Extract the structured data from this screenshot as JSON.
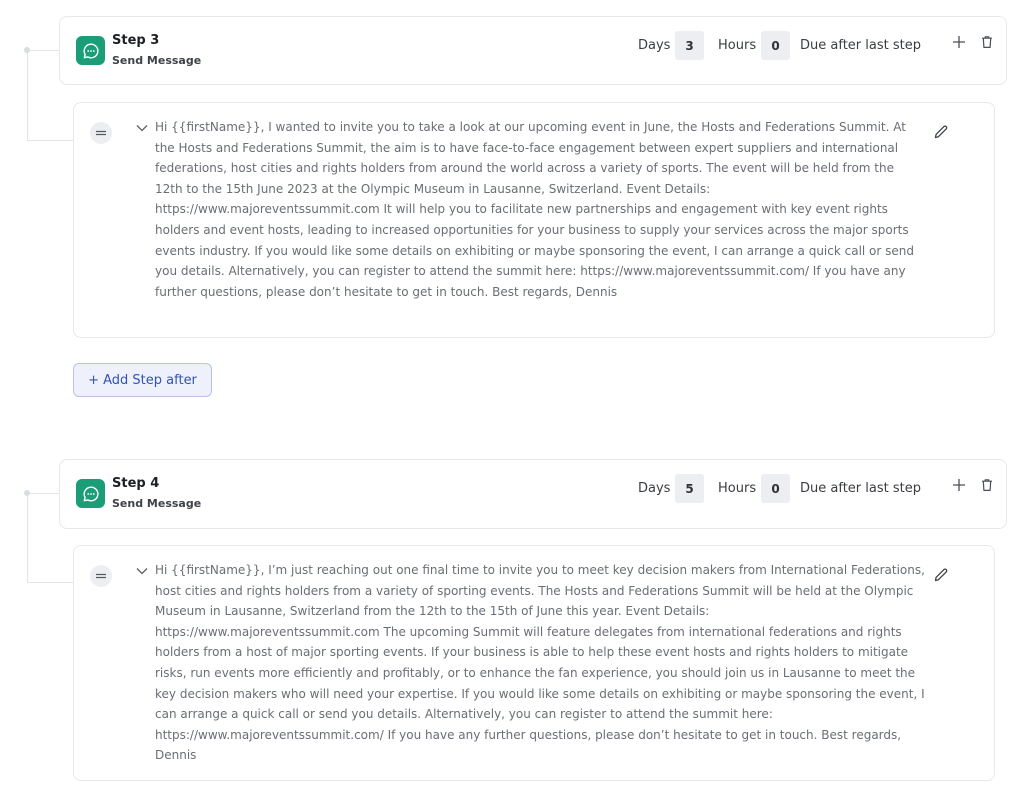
{
  "steps": [
    {
      "title": "Step 3",
      "subtitle": "Send Message",
      "days_label": "Days",
      "days_value": "3",
      "hours_label": "Hours",
      "hours_value": "0",
      "due_label": "Due after last step",
      "message": "Hi {{firstName}}, I wanted to invite you to take a look at our upcoming event in June, the Hosts and Federations Summit. At the Hosts and Federations Summit, the aim is to have face-to-face engagement between expert suppliers and international federations, host cities and rights holders from around the world across a variety of sports. The event will be held from the 12th to the 15th June 2023 at the Olympic Museum in Lausanne, Switzerland. Event Details: https://www.majoreventssummit.com It will help you to facilitate new partnerships and engagement with key event rights holders and event hosts, leading to increased opportunities for your business to supply your services across the major sports events industry. If you would like some details on exhibiting or maybe sponsoring the event, I can arrange a quick call or send you details. Alternatively, you can register to attend the summit here: https://www.majoreventssummit.com/ If you have any further questions, please don’t hesitate to get in touch. Best regards, Dennis"
    },
    {
      "title": "Step 4",
      "subtitle": "Send Message",
      "days_label": "Days",
      "days_value": "5",
      "hours_label": "Hours",
      "hours_value": "0",
      "due_label": "Due after last step",
      "message": "Hi {{firstName}}, I’m just reaching out one final time to invite you to meet key decision makers from International Federations, host cities and rights holders from a variety of sporting events. The Hosts and Federations Summit will be held at the Olympic Museum in Lausanne, Switzerland from the 12th to the 15th of June this year. Event Details: https://www.majoreventssummit.com The upcoming Summit will feature delegates from international federations and rights holders from a host of major sporting events. If your business is able to help these event hosts and rights holders to mitigate risks, run events more efficiently and profitably, or to enhance the fan experience, you should join us in Lausanne to meet the key decision makers who will need your expertise. If you would like some details on exhibiting or maybe sponsoring the event, I can arrange a quick call or send you details. Alternatively, you can register to attend the summit here: https://www.majoreventssummit.com/ If you have any further questions, please don’t hesitate to get in touch. Best regards, Dennis"
    }
  ],
  "add_step_label": "+ Add Step after",
  "icons": {
    "step": "chat-bubble-icon",
    "add": "plus-icon",
    "delete": "trash-icon",
    "drag": "drag-handle-icon",
    "collapse": "chevron-down-icon",
    "edit": "pencil-icon"
  },
  "colors": {
    "step_icon_bg": "#1b9e77",
    "add_step_text": "#3452b4",
    "add_step_bg": "#eef1fb"
  }
}
